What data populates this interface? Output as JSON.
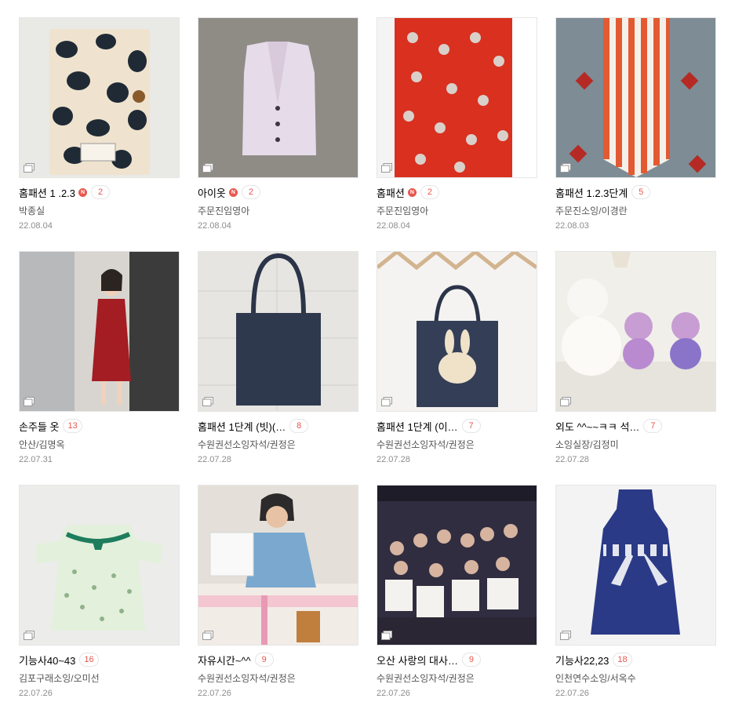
{
  "posts": [
    {
      "title": "홈패션 1 .2.3",
      "is_new": true,
      "new_label": "N",
      "comments": "2",
      "author": "박종실",
      "date": "22.08.04",
      "image": "book-cover-monstera-fabric"
    },
    {
      "title": "아이옷",
      "is_new": true,
      "new_label": "N",
      "comments": "2",
      "author": "주문진임영아",
      "date": "22.08.04",
      "image": "lavender-child-vest"
    },
    {
      "title": "홈패션",
      "is_new": true,
      "new_label": "N",
      "comments": "2",
      "author": "주문진임영아",
      "date": "22.08.04",
      "image": "red-rabbit-quilt"
    },
    {
      "title": "홈패션 1.2.3단계",
      "is_new": false,
      "comments": "5",
      "author": "주문진소잉/이경란",
      "date": "22.08.03",
      "image": "striped-table-runner"
    },
    {
      "title": "손주들 옷",
      "is_new": false,
      "comments": "13",
      "author": "안산/김명옥",
      "date": "22.07.31",
      "image": "girl-red-dress"
    },
    {
      "title": "홈패션 1단계 (빗)(…",
      "is_new": false,
      "comments": "8",
      "author": "수원권선소잉자석/권정은",
      "date": "22.07.28",
      "image": "denim-tote-bag"
    },
    {
      "title": "홈패션 1단계 (이…",
      "is_new": false,
      "comments": "7",
      "author": "수원권선소잉자석/권정은",
      "date": "22.07.28",
      "image": "denim-bunny-bag"
    },
    {
      "title": "외도 ^^~~ㅋㅋ 석…",
      "is_new": false,
      "comments": "7",
      "author": "소잉실장/김정미",
      "date": "22.07.28",
      "image": "poodle-figurines"
    },
    {
      "title": "기능사40~43",
      "is_new": false,
      "comments": "16",
      "author": "김포구래소잉/오미선",
      "date": "22.07.26",
      "image": "floral-baby-dress"
    },
    {
      "title": "자유시간~^^",
      "is_new": false,
      "comments": "9",
      "author": "수원권선소잉자석/권정은",
      "date": "22.07.26",
      "image": "woman-sewing-machine"
    },
    {
      "title": "오산 사랑의 대사…",
      "is_new": false,
      "comments": "9",
      "author": "수원권선소잉자석/권정은",
      "date": "22.07.26",
      "image": "group-certificates"
    },
    {
      "title": "기능사22,23",
      "is_new": false,
      "comments": "18",
      "author": "인천연수소잉/서옥수",
      "date": "22.07.26",
      "image": "navy-bow-dress"
    }
  ],
  "colors": {
    "accent": "#e8574f",
    "author": "#555555",
    "date": "#8c8c8c"
  }
}
